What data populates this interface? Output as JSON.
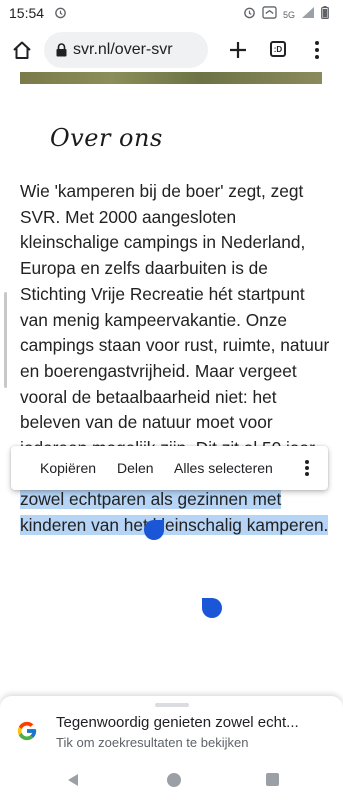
{
  "status_bar": {
    "time": "15:54",
    "network": "5G"
  },
  "browser": {
    "url": "svr.nl/over-svr",
    "tabs_label": ":D"
  },
  "page": {
    "section_title": "Over ons",
    "paragraph_plain": "Wie 'kamperen bij de boer' zegt, zegt SVR. Met 2000 aangesloten kleinschalige campings in Nederland, Europa en zelfs daarbuiten is de Stichting Vrije Recreatie hét startpunt van menig kampeervakantie. Onze campings staan voor rust, ruimte, natuur en boerengastvrijheid. Maar vergeet vooral de betaalbaarheid niet: het beleven van de natuur moet voor iedereen mogelijk zijn. Dit zit al 50 jaar in ons 'DNA'! ",
    "paragraph_selected": "Tegenwoordig genieten zowel echtparen als gezinnen met kinderen van het kleinschalig kamperen."
  },
  "context_menu": {
    "copy": "Kopiëren",
    "share": "Delen",
    "select_all": "Alles selecteren"
  },
  "search_sheet": {
    "title": "Tegenwoordig genieten zowel echt...",
    "subtitle": "Tik om zoekresultaten te bekijken"
  },
  "colors": {
    "selection": "#b6d4f5",
    "handle": "#1a56d6"
  }
}
